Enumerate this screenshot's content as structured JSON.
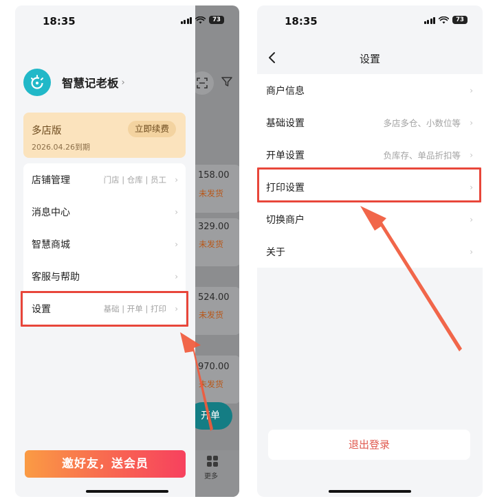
{
  "left": {
    "status_bar": {
      "time": "18:35",
      "battery": "73"
    },
    "profile": {
      "shop_name": "智慧记老板",
      "chevron": "›"
    },
    "membership": {
      "plan": "多店版",
      "expiry": "2026.04.26到期",
      "renew_label": "立即续费"
    },
    "menu": [
      {
        "label": "店铺管理",
        "sub": "门店 | 仓库 | 员工"
      },
      {
        "label": "消息中心",
        "sub": ""
      },
      {
        "label": "智慧商城",
        "sub": ""
      },
      {
        "label": "客服与帮助",
        "sub": ""
      },
      {
        "label": "设置",
        "sub": "基础 | 开单 | 打印"
      }
    ],
    "invite_banner": "邀好友，送会员",
    "background_page": {
      "orders": [
        {
          "amount": "158.00",
          "status": "未发货"
        },
        {
          "amount": "329.00",
          "status": "未发货"
        },
        {
          "amount": "524.00",
          "status": "未发货"
        },
        {
          "amount": "970.00",
          "status": "未发货"
        }
      ],
      "open_button": "开单",
      "more_tab": "更多"
    }
  },
  "right": {
    "status_bar": {
      "time": "18:35",
      "battery": "73"
    },
    "nav": {
      "title": "设置"
    },
    "settings": [
      {
        "label": "商户信息",
        "sub": ""
      },
      {
        "label": "基础设置",
        "sub": "多店多仓、小数位等"
      },
      {
        "label": "开单设置",
        "sub": "负库存、单品折扣等"
      },
      {
        "label": "打印设置",
        "sub": ""
      },
      {
        "label": "切换商户",
        "sub": ""
      },
      {
        "label": "关于",
        "sub": ""
      }
    ],
    "logout_label": "退出登录"
  },
  "chevron": "›",
  "colors": {
    "highlight": "#e8463a",
    "arrow": "#f05a3c",
    "accent": "#147d84",
    "avatar": "#21b8c8",
    "logout_text": "#e05a4f"
  }
}
